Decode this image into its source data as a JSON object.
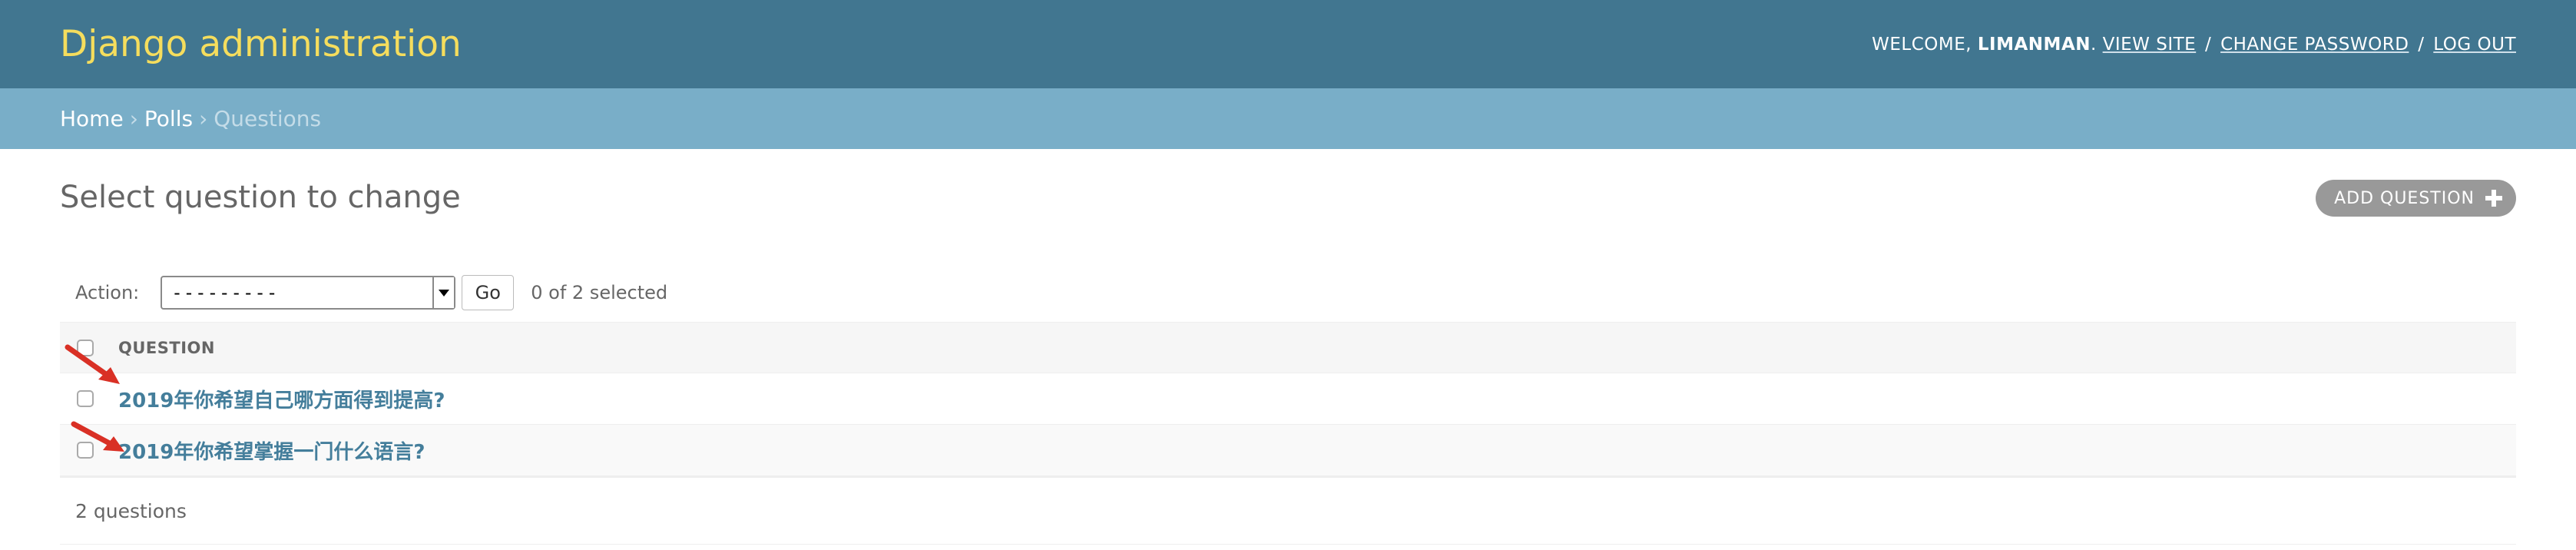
{
  "header": {
    "site_name": "Django administration",
    "welcome_prefix": "WELCOME,",
    "username": "LIMANMAN",
    "welcome_suffix": ".",
    "view_site": "VIEW SITE",
    "change_password": "CHANGE PASSWORD",
    "log_out": "LOG OUT",
    "separator": "/"
  },
  "breadcrumbs": {
    "home": "Home",
    "app": "Polls",
    "current": "Questions",
    "separator": "›"
  },
  "main": {
    "title": "Select question to change",
    "add_button": "ADD QUESTION"
  },
  "actions": {
    "label": "Action:",
    "selected_value": "---------",
    "go_label": "Go",
    "selection_count": "0 of 2 selected"
  },
  "table": {
    "column_header": "QUESTION",
    "rows": [
      {
        "question": "2019年你希望自己哪方面得到提高?"
      },
      {
        "question": "2019年你希望掌握一门什么语言?"
      }
    ],
    "footer": "2 questions"
  },
  "colors": {
    "header_bg": "#417690",
    "breadcrumb_bg": "#79aec8",
    "site_name": "#f5dd5d",
    "link": "#447e9b",
    "annotation_arrow": "#d93025"
  }
}
